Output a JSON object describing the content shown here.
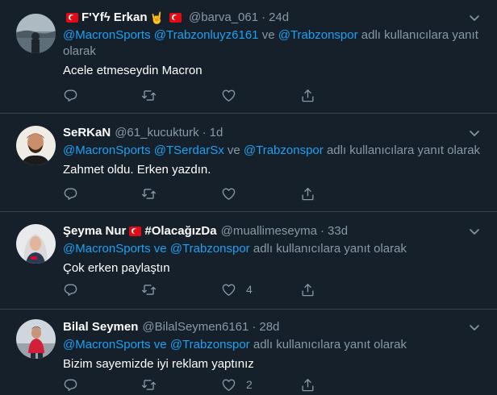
{
  "tweets": [
    {
      "name_prefix": "F'Yfϟ Erkan",
      "handle": "@barva_061",
      "time": "24d",
      "reply_mentions": [
        "@MacronSports",
        "@Trabzonluyz6161",
        "@Trabzonspor"
      ],
      "reply_connector": "ve",
      "reply_suffix": "adlı kullanıcılara yanıt olarak",
      "text": "Acele etmeseydin Macron",
      "like_count": ""
    },
    {
      "name": "SeRKaN",
      "handle": "@61_kucukturk",
      "time": "1d",
      "reply_mentions": [
        "@MacronSports",
        "@TSerdarSx",
        "@Trabzonspor"
      ],
      "reply_connector": "ve",
      "reply_suffix": "adlı kullanıcılara yanıt olarak",
      "text": "Zahmet oldu. Erken yazdın.",
      "like_count": ""
    },
    {
      "name": "Şeyma Nur",
      "name_suffix": "#OlacağızDa",
      "handle": "@muallimeseyma",
      "time": "33d",
      "reply_mentions": [
        "@MacronSports",
        "@Trabzonspor"
      ],
      "reply_connector": "ve",
      "reply_suffix": "adlı kullanıcılara yanıt olarak",
      "text": "Çok erken paylaştın",
      "like_count": "4"
    },
    {
      "name": "Bilal Seymen",
      "handle": "@BilalSeymen6161",
      "time": "28d",
      "reply_mentions": [
        "@MacronSports",
        "@Trabzonspor"
      ],
      "reply_connector": "ve",
      "reply_suffix": "adlı kullanıcılara yanıt olarak",
      "text": "Bizim sayemizde iyi reklam yaptınız",
      "like_count": "2"
    }
  ],
  "separator": "·",
  "icons": {
    "reply": "reply-icon",
    "retweet": "retweet-icon",
    "like": "heart-icon",
    "share": "share-icon",
    "more": "chevron-down-icon",
    "flag": "turkish-flag-icon",
    "hand": "rock-hand-emoji"
  },
  "colors": {
    "background": "#15202b",
    "border": "#38444d",
    "secondary_text": "#8899a6",
    "link": "#1da1f2"
  }
}
